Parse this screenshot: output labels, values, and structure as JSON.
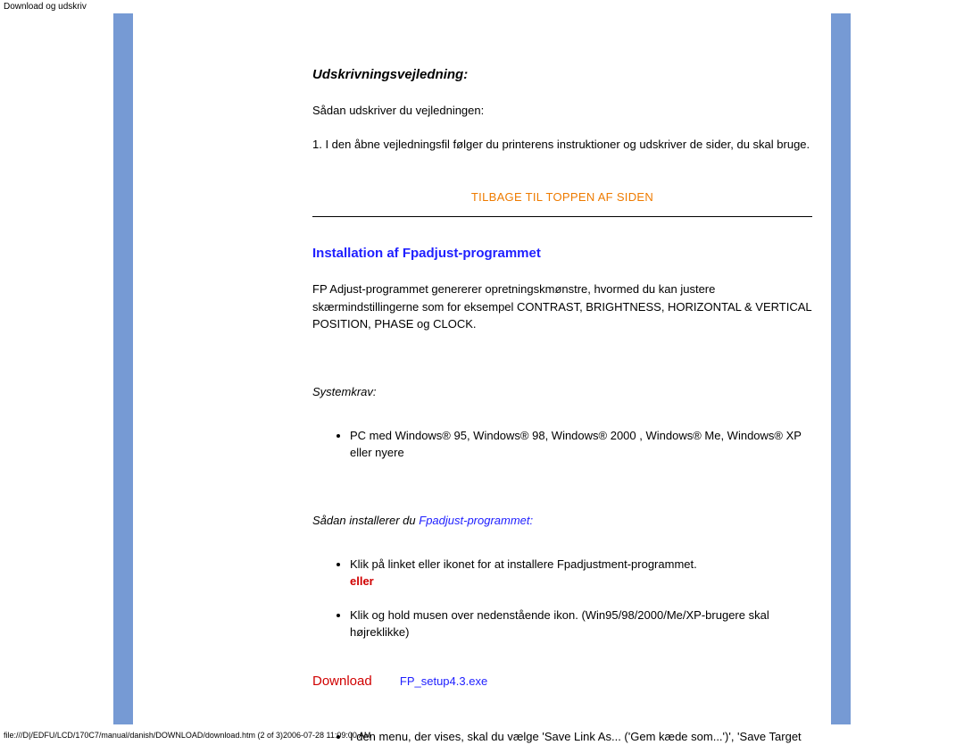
{
  "header": {
    "label": "Download og udskriv"
  },
  "section1": {
    "heading": "Udskrivningsvejledning:",
    "intro": "Sådan udskriver du vejledningen:",
    "step1": "1. I den åbne vejledningsfil følger du printerens instruktioner og udskriver de sider, du skal bruge."
  },
  "backlink": {
    "label": "TILBAGE TIL TOPPEN AF SIDEN"
  },
  "section2": {
    "heading": "Installation af Fpadjust-programmet",
    "desc": "FP Adjust-programmet genererer opretningskmønstre, hvormed du kan justere skærmindstillingerne som for eksempel CONTRAST, BRIGHTNESS, HORIZONTAL & VERTICAL POSITION, PHASE og CLOCK.",
    "syskrav_label": "Systemkrav:",
    "syskrav_item": "PC med Windows® 95, Windows® 98, Windows® 2000 , Windows® Me, Windows® XP eller nyere",
    "install_prefix": "Sådan installerer du ",
    "install_link": "Fpadjust-programmet:",
    "bullet1": "Klik på linket eller ikonet for at installere Fpadjustment-programmet.",
    "eller": "eller",
    "bullet2": "Klik og hold musen over nedenstående ikon. (Win95/98/2000/Me/XP-brugere skal højreklikke)",
    "download_label": "Download",
    "download_file": "FP_setup4.3.exe",
    "bullet3": "I den menu, der vises, skal du vælge 'Save Link As... ('Gem kæde som...')', 'Save Target"
  },
  "footer": {
    "path": "file:///D|/EDFU/LCD/170C7/manual/danish/DOWNLOAD/download.htm (2 of 3)2006-07-28 11:09:00 AM"
  }
}
